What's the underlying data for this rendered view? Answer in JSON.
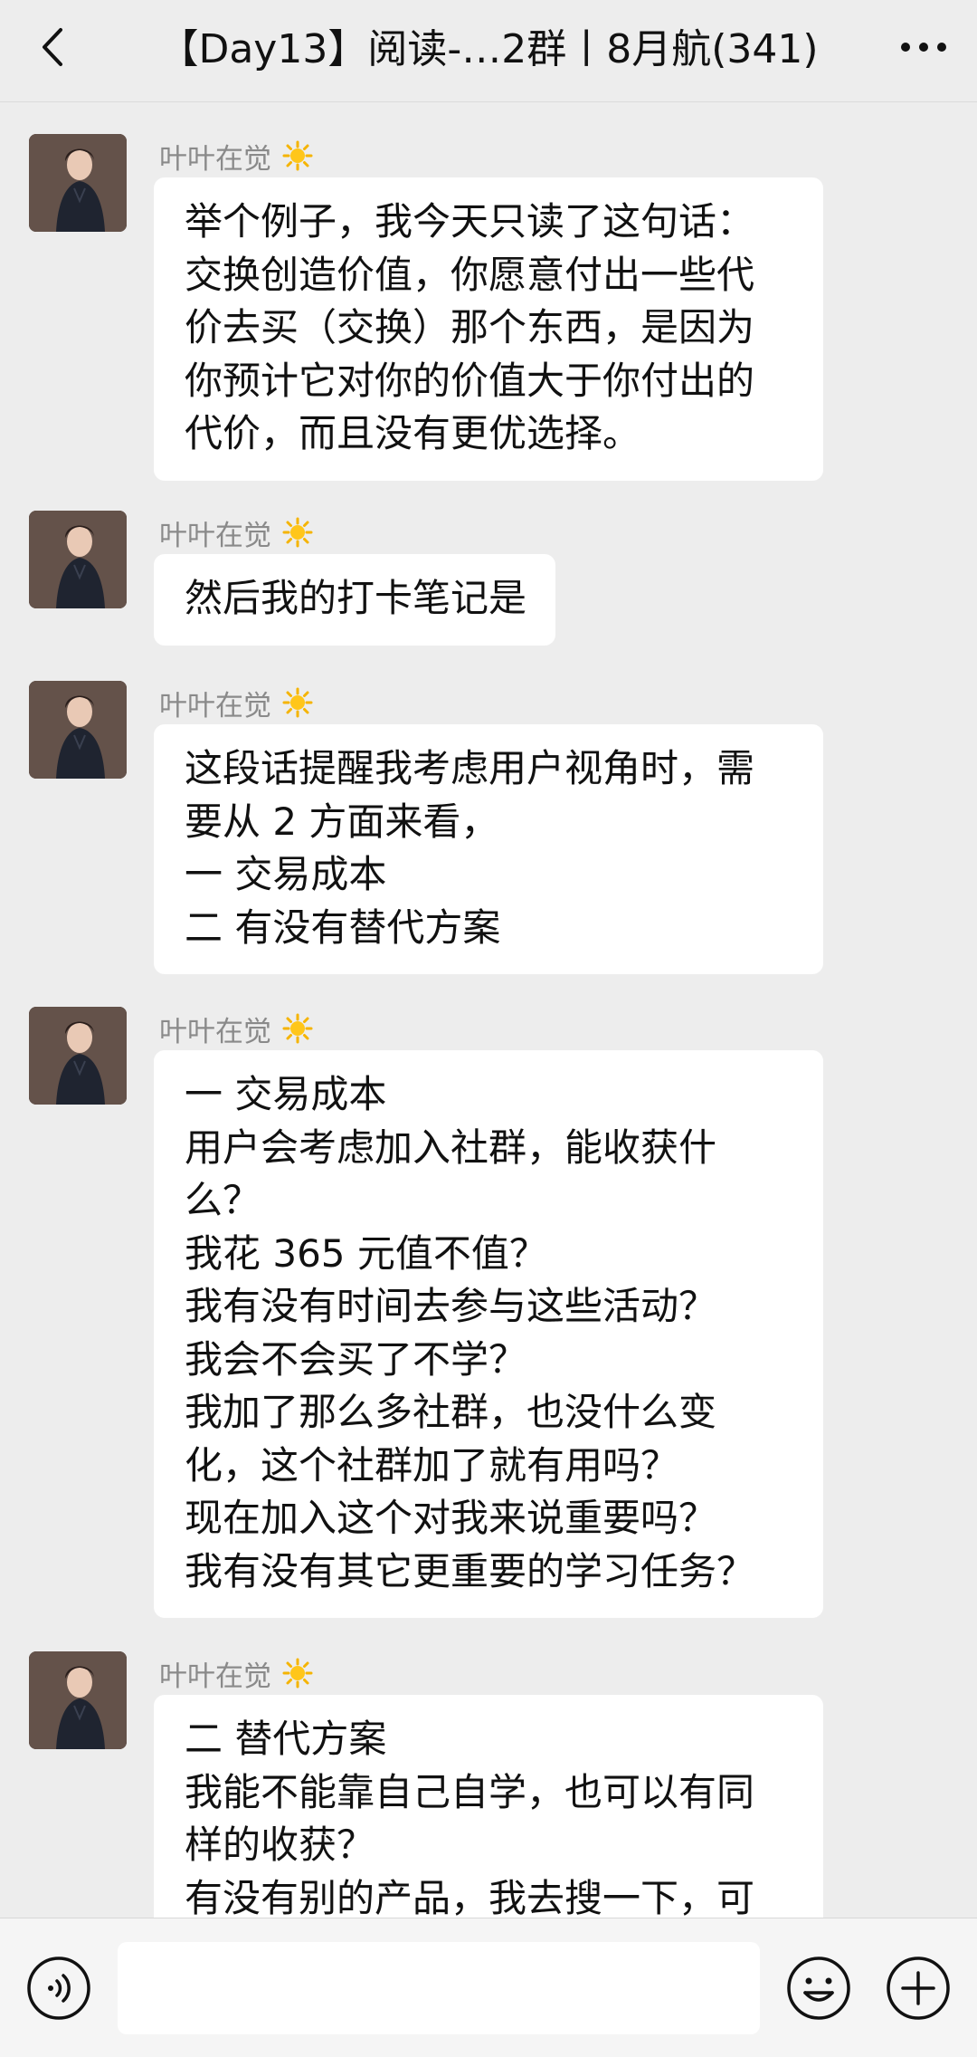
{
  "header": {
    "title": "【Day13】阅读-…2群丨8月航(341)"
  },
  "composer": {
    "input_value": ""
  },
  "messages": [
    {
      "sender": "叶叶在觉",
      "text": "举个例子，我今天只读了这句话：\n交换创造价值，你愿意付出一些代\n价去买（交换）那个东西，是因为\n你预计它对你的价值大于你付出的\n代价，而且没有更优选择。"
    },
    {
      "sender": "叶叶在觉",
      "text": "然后我的打卡笔记是"
    },
    {
      "sender": "叶叶在觉",
      "text": "这段话提醒我考虑用户视角时，需\n要从 2 方面来看，\n一 交易成本\n二 有没有替代方案"
    },
    {
      "sender": "叶叶在觉",
      "text": "一 交易成本\n用户会考虑加入社群，能收获什\n么？\n我花 365 元值不值？\n我有没有时间去参与这些活动？\n我会不会买了不学？\n我加了那么多社群，也没什么变\n化，这个社群加了就有用吗？\n现在加入这个对我来说重要吗？\n我有没有其它更重要的学习任务？"
    },
    {
      "sender": "叶叶在觉",
      "text": "二 替代方案\n我能不能靠自己自学，也可以有同\n样的收获？\n有没有别的产品，我去搜一下，可"
    }
  ]
}
